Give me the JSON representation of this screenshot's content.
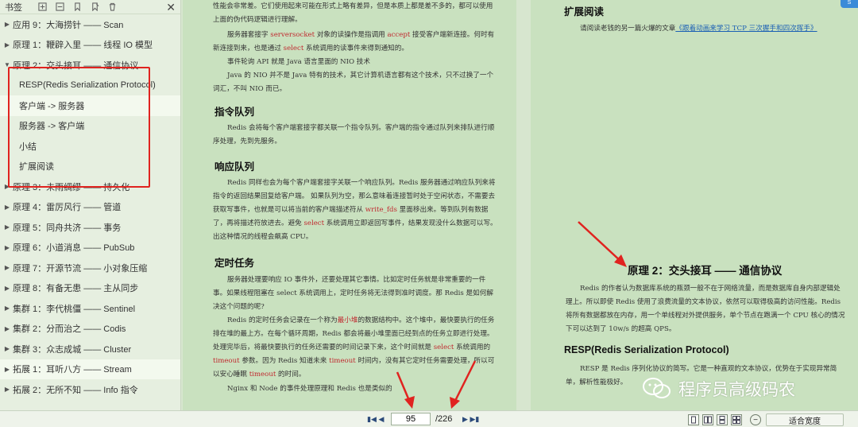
{
  "sidebar": {
    "title": "书签",
    "items": [
      {
        "label": "应用 9：大海捞针 —— Scan",
        "arrow": "▶",
        "child": false,
        "highlight": false
      },
      {
        "label": "原理 1：鞭辟入里 —— 线程 IO 模型",
        "arrow": "▶",
        "child": false,
        "highlight": false
      },
      {
        "label": "原理 2：交头接耳 —— 通信协议",
        "arrow": "▼",
        "child": false,
        "highlight": false
      },
      {
        "label": "RESP(Redis Serialization Protocol)",
        "arrow": "",
        "child": true,
        "highlight": false
      },
      {
        "label": "客户端 -> 服务器",
        "arrow": "",
        "child": true,
        "highlight": true
      },
      {
        "label": "服务器 -> 客户端",
        "arrow": "",
        "child": true,
        "highlight": false
      },
      {
        "label": "小结",
        "arrow": "",
        "child": true,
        "highlight": false
      },
      {
        "label": "扩展阅读",
        "arrow": "",
        "child": true,
        "highlight": false
      },
      {
        "label": "原理 3：未雨绸缪 —— 持久化",
        "arrow": "▶",
        "child": false,
        "highlight": false
      },
      {
        "label": "原理 4：雷厉风行 —— 管道",
        "arrow": "▶",
        "child": false,
        "highlight": false
      },
      {
        "label": "原理 5：同舟共济 —— 事务",
        "arrow": "▶",
        "child": false,
        "highlight": false
      },
      {
        "label": "原理 6：小道消息 —— PubSub",
        "arrow": "▶",
        "child": false,
        "highlight": false
      },
      {
        "label": "原理 7：开源节流 —— 小对象压缩",
        "arrow": "▶",
        "child": false,
        "highlight": false
      },
      {
        "label": "原理 8：有备无患 —— 主从同步",
        "arrow": "▶",
        "child": false,
        "highlight": false
      },
      {
        "label": "集群 1：李代桃僵 —— Sentinel",
        "arrow": "▶",
        "child": false,
        "highlight": false
      },
      {
        "label": "集群 2：分而治之 —— Codis",
        "arrow": "▶",
        "child": false,
        "highlight": false
      },
      {
        "label": "集群 3：众志成城 —— Cluster",
        "arrow": "▶",
        "child": false,
        "highlight": false
      },
      {
        "label": "拓展 1：耳听八方 —— Stream",
        "arrow": "▶",
        "child": false,
        "highlight": true
      },
      {
        "label": "拓展 2：无所不知 —— Info 指令",
        "arrow": "▶",
        "child": false,
        "highlight": false
      }
    ]
  },
  "left_page": {
    "p1": "性能会非常差。它们使用起来可能在形式上略有差异，但是本质上都是差不多的，都可以使用上面的伪代码逻辑进行理解。",
    "p2_a": "服务器套接字 ",
    "p2_hl1": "serversocket",
    "p2_b": " 对象的读操作是指调用 ",
    "p2_hl2": "accept",
    "p2_c": " 接受客户端新连接。何时有新连接到来，也是通过 ",
    "p2_hl3": "select",
    "p2_d": " 系统调用的读事件来得到通知的。",
    "p3": "事件轮询 API 就是 Java 语言里面的 NIO 技术",
    "p4": "Java 的 NIO 并不是 Java 特有的技术，其它计算机语言都有这个技术，只不过换了一个词汇，不叫 NIO 而已。",
    "h_cmd": "指令队列",
    "p5": "Redis 会将每个客户端套接字都关联一个指令队列。客户端的指令通过队列来排队进行顺序处理，先到先服务。",
    "h_resp": "响应队列",
    "p6_a": "Redis 同样也会为每个客户端套接字关联一个响应队列。Redis 服务器通过响应队列来将指令的返回结果回复给客户端。 如果队列为空，那么意味着连接暂时处于空闲状态，不需要去获取写事件，也就是可以将当前的客户端描述符从 ",
    "p6_hl1": "write_fds",
    "p6_b": " 里面移出来。等到队列有数据了，再将描述符放进去。避免 ",
    "p6_hl2": "select",
    "p6_c": " 系统调用立即返回写事件，结果发现没什么数据可以写。出这种情况的线程会飙高 CPU。",
    "h_timer": "定时任务",
    "p7": "服务器处理要响应 IO 事件外，还要处理其它事情。比如定时任务就是非常重要的一件事。如果线程阻塞在 select 系统调用上，定时任务将无法得到准时调度。那 Redis 是如何解决这个问题的呢?",
    "p8_a": "Redis 的定时任务会记录在一个称为",
    "p8_hl1": "最小堆",
    "p8_b": "的数据结构中。这个堆中，最快要执行的任务排在堆的最上方。在每个循环周期，Redis 都会将最小堆里面已经到点的任务立即进行处理。处理完毕后，将最快要执行的任务还需要的时间记录下来，这个时间就是 ",
    "p8_hl2": "select",
    "p8_c": " 系统调用的 ",
    "p8_hl3": "timeout",
    "p8_d": " 参数。因为 Redis 知道未来 ",
    "p8_hl4": "timeout",
    "p8_e": " 时间内，没有其它定时任务需要处理，所以可以安心睡眠 ",
    "p8_hl5": "timeout",
    "p8_f": " 的时间。",
    "p9": "Nginx 和 Node 的事件处理原理和 Redis 也是类似的"
  },
  "right_page": {
    "h_ext": "扩展阅读",
    "p_ext_a": "请阅读老钱的另一篇火爆的文章",
    "p_ext_link": "《跟着动画来学习 TCP 三次握手和四次挥手》",
    "chapter_title": "原理 2：交头接耳 —— 通信协议",
    "p_intro": "Redis 的作者认为数据库系统的瓶颈一般不在于网络流量，而是数据库自身内部逻辑处理上。所以即使 Redis 使用了浪费流量的文本协议，依然可以取得极高的访问性能。Redis 将所有数据都放在内存，用一个单线程对外提供服务，单个节点在跑满一个 CPU 核心的情况下可以达到了 10w/s 的超高 QPS。",
    "h_resp": "RESP(Redis Serialization Protocol)",
    "p_resp": "RESP 是 Redis 序列化协议的简写。它是一种直观的文本协议，优势在于实现异常简单，解析性能极好。",
    "badge": "S"
  },
  "watermark": "程序员高级码农",
  "bottombar": {
    "current_page": "95",
    "total_pages": "/226",
    "zoom_mode": "适合宽度"
  },
  "colors": {
    "annotation_red": "#e0231f",
    "page_bg": "#c9e1bf",
    "highlight_text": "#c0292f"
  }
}
